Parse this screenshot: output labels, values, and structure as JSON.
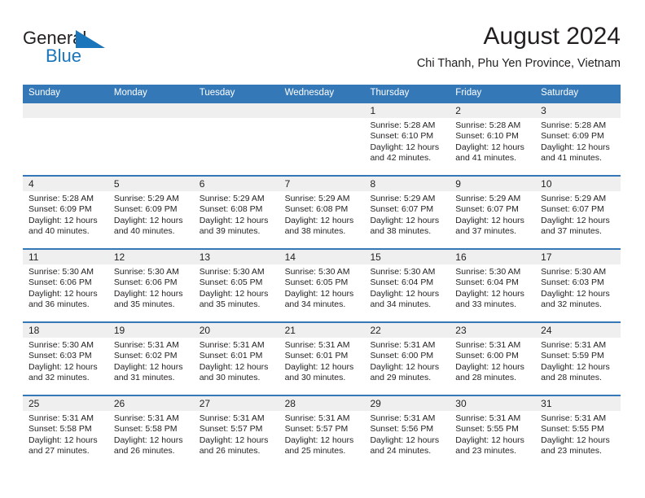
{
  "brand": {
    "name_part1": "General",
    "name_part2": "Blue",
    "color_dark": "#231f20",
    "color_blue": "#1b75bb"
  },
  "header": {
    "title": "August 2024",
    "subtitle": "Chi Thanh, Phu Yen Province, Vietnam",
    "accent_color": "#3478b8",
    "date_band_color": "#efeff0"
  },
  "weekdays": [
    "Sunday",
    "Monday",
    "Tuesday",
    "Wednesday",
    "Thursday",
    "Friday",
    "Saturday"
  ],
  "weeks": [
    {
      "days": [
        {
          "date": "",
          "sunrise": "",
          "sunset": "",
          "daylight1": "",
          "daylight2": ""
        },
        {
          "date": "",
          "sunrise": "",
          "sunset": "",
          "daylight1": "",
          "daylight2": ""
        },
        {
          "date": "",
          "sunrise": "",
          "sunset": "",
          "daylight1": "",
          "daylight2": ""
        },
        {
          "date": "",
          "sunrise": "",
          "sunset": "",
          "daylight1": "",
          "daylight2": ""
        },
        {
          "date": "1",
          "sunrise": "Sunrise: 5:28 AM",
          "sunset": "Sunset: 6:10 PM",
          "daylight1": "Daylight: 12 hours",
          "daylight2": "and 42 minutes."
        },
        {
          "date": "2",
          "sunrise": "Sunrise: 5:28 AM",
          "sunset": "Sunset: 6:10 PM",
          "daylight1": "Daylight: 12 hours",
          "daylight2": "and 41 minutes."
        },
        {
          "date": "3",
          "sunrise": "Sunrise: 5:28 AM",
          "sunset": "Sunset: 6:09 PM",
          "daylight1": "Daylight: 12 hours",
          "daylight2": "and 41 minutes."
        }
      ]
    },
    {
      "days": [
        {
          "date": "4",
          "sunrise": "Sunrise: 5:28 AM",
          "sunset": "Sunset: 6:09 PM",
          "daylight1": "Daylight: 12 hours",
          "daylight2": "and 40 minutes."
        },
        {
          "date": "5",
          "sunrise": "Sunrise: 5:29 AM",
          "sunset": "Sunset: 6:09 PM",
          "daylight1": "Daylight: 12 hours",
          "daylight2": "and 40 minutes."
        },
        {
          "date": "6",
          "sunrise": "Sunrise: 5:29 AM",
          "sunset": "Sunset: 6:08 PM",
          "daylight1": "Daylight: 12 hours",
          "daylight2": "and 39 minutes."
        },
        {
          "date": "7",
          "sunrise": "Sunrise: 5:29 AM",
          "sunset": "Sunset: 6:08 PM",
          "daylight1": "Daylight: 12 hours",
          "daylight2": "and 38 minutes."
        },
        {
          "date": "8",
          "sunrise": "Sunrise: 5:29 AM",
          "sunset": "Sunset: 6:07 PM",
          "daylight1": "Daylight: 12 hours",
          "daylight2": "and 38 minutes."
        },
        {
          "date": "9",
          "sunrise": "Sunrise: 5:29 AM",
          "sunset": "Sunset: 6:07 PM",
          "daylight1": "Daylight: 12 hours",
          "daylight2": "and 37 minutes."
        },
        {
          "date": "10",
          "sunrise": "Sunrise: 5:29 AM",
          "sunset": "Sunset: 6:07 PM",
          "daylight1": "Daylight: 12 hours",
          "daylight2": "and 37 minutes."
        }
      ]
    },
    {
      "days": [
        {
          "date": "11",
          "sunrise": "Sunrise: 5:30 AM",
          "sunset": "Sunset: 6:06 PM",
          "daylight1": "Daylight: 12 hours",
          "daylight2": "and 36 minutes."
        },
        {
          "date": "12",
          "sunrise": "Sunrise: 5:30 AM",
          "sunset": "Sunset: 6:06 PM",
          "daylight1": "Daylight: 12 hours",
          "daylight2": "and 35 minutes."
        },
        {
          "date": "13",
          "sunrise": "Sunrise: 5:30 AM",
          "sunset": "Sunset: 6:05 PM",
          "daylight1": "Daylight: 12 hours",
          "daylight2": "and 35 minutes."
        },
        {
          "date": "14",
          "sunrise": "Sunrise: 5:30 AM",
          "sunset": "Sunset: 6:05 PM",
          "daylight1": "Daylight: 12 hours",
          "daylight2": "and 34 minutes."
        },
        {
          "date": "15",
          "sunrise": "Sunrise: 5:30 AM",
          "sunset": "Sunset: 6:04 PM",
          "daylight1": "Daylight: 12 hours",
          "daylight2": "and 34 minutes."
        },
        {
          "date": "16",
          "sunrise": "Sunrise: 5:30 AM",
          "sunset": "Sunset: 6:04 PM",
          "daylight1": "Daylight: 12 hours",
          "daylight2": "and 33 minutes."
        },
        {
          "date": "17",
          "sunrise": "Sunrise: 5:30 AM",
          "sunset": "Sunset: 6:03 PM",
          "daylight1": "Daylight: 12 hours",
          "daylight2": "and 32 minutes."
        }
      ]
    },
    {
      "days": [
        {
          "date": "18",
          "sunrise": "Sunrise: 5:30 AM",
          "sunset": "Sunset: 6:03 PM",
          "daylight1": "Daylight: 12 hours",
          "daylight2": "and 32 minutes."
        },
        {
          "date": "19",
          "sunrise": "Sunrise: 5:31 AM",
          "sunset": "Sunset: 6:02 PM",
          "daylight1": "Daylight: 12 hours",
          "daylight2": "and 31 minutes."
        },
        {
          "date": "20",
          "sunrise": "Sunrise: 5:31 AM",
          "sunset": "Sunset: 6:01 PM",
          "daylight1": "Daylight: 12 hours",
          "daylight2": "and 30 minutes."
        },
        {
          "date": "21",
          "sunrise": "Sunrise: 5:31 AM",
          "sunset": "Sunset: 6:01 PM",
          "daylight1": "Daylight: 12 hours",
          "daylight2": "and 30 minutes."
        },
        {
          "date": "22",
          "sunrise": "Sunrise: 5:31 AM",
          "sunset": "Sunset: 6:00 PM",
          "daylight1": "Daylight: 12 hours",
          "daylight2": "and 29 minutes."
        },
        {
          "date": "23",
          "sunrise": "Sunrise: 5:31 AM",
          "sunset": "Sunset: 6:00 PM",
          "daylight1": "Daylight: 12 hours",
          "daylight2": "and 28 minutes."
        },
        {
          "date": "24",
          "sunrise": "Sunrise: 5:31 AM",
          "sunset": "Sunset: 5:59 PM",
          "daylight1": "Daylight: 12 hours",
          "daylight2": "and 28 minutes."
        }
      ]
    },
    {
      "days": [
        {
          "date": "25",
          "sunrise": "Sunrise: 5:31 AM",
          "sunset": "Sunset: 5:58 PM",
          "daylight1": "Daylight: 12 hours",
          "daylight2": "and 27 minutes."
        },
        {
          "date": "26",
          "sunrise": "Sunrise: 5:31 AM",
          "sunset": "Sunset: 5:58 PM",
          "daylight1": "Daylight: 12 hours",
          "daylight2": "and 26 minutes."
        },
        {
          "date": "27",
          "sunrise": "Sunrise: 5:31 AM",
          "sunset": "Sunset: 5:57 PM",
          "daylight1": "Daylight: 12 hours",
          "daylight2": "and 26 minutes."
        },
        {
          "date": "28",
          "sunrise": "Sunrise: 5:31 AM",
          "sunset": "Sunset: 5:57 PM",
          "daylight1": "Daylight: 12 hours",
          "daylight2": "and 25 minutes."
        },
        {
          "date": "29",
          "sunrise": "Sunrise: 5:31 AM",
          "sunset": "Sunset: 5:56 PM",
          "daylight1": "Daylight: 12 hours",
          "daylight2": "and 24 minutes."
        },
        {
          "date": "30",
          "sunrise": "Sunrise: 5:31 AM",
          "sunset": "Sunset: 5:55 PM",
          "daylight1": "Daylight: 12 hours",
          "daylight2": "and 23 minutes."
        },
        {
          "date": "31",
          "sunrise": "Sunrise: 5:31 AM",
          "sunset": "Sunset: 5:55 PM",
          "daylight1": "Daylight: 12 hours",
          "daylight2": "and 23 minutes."
        }
      ]
    }
  ]
}
